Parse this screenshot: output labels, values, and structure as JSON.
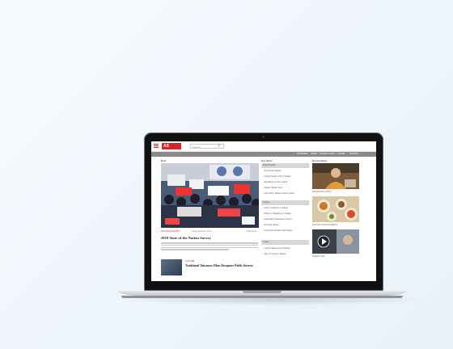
{
  "header": {
    "logo_text": "AS",
    "search_placeholder": "Search"
  },
  "nav": [
    "FEATURES",
    "NEWS",
    "TAIWAN TODAY",
    "TRAVEL",
    "OPINION",
    "CULTURE",
    "SPORTS"
  ],
  "main": {
    "section_title": "Now",
    "category": "POLITICS & SOCIETY",
    "category_meta": "Taiwan Business Topics",
    "date": "2024-04-03",
    "headline": "2019 State of the Nation Survey",
    "second_category": "CULTURE",
    "second_headline": "Traditional Taiwanese Films Recapture Public Interest"
  },
  "hot": {
    "title": "Hot Items",
    "box1_title": "Most Popular",
    "box1_items": [
      "Tomorrow's Taiwan",
      "Young People's Life in Taiwan",
      "Revisiting our Own Island",
      "Taiwan Harbor Tours",
      "Can't Miss: Taiwan's Finest Views"
    ],
    "box2_title": "Culture",
    "box2_items": [
      "Cities of Flowers in Taiwan",
      "Where is Happiness in Taiwan",
      "Celebrating Taiwanese Culture",
      "Amazing Taiwan",
      "Connecting People with Nature"
    ],
    "box3_title": "Travel",
    "box3_items": [
      "Local Cuisine Around Taiwan",
      "Tips on Travel in Taiwan"
    ]
  },
  "recommend": {
    "title": "Recommend",
    "items": [
      "TRADITIONAL RITES",
      "FESTIVAL FOOD & EVENTS",
      "TAIWAN FILM"
    ]
  }
}
